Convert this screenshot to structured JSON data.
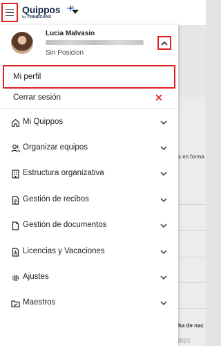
{
  "app": {
    "logo_main": "Quippos",
    "logo_sub_prefix": "by ",
    "logo_sub_brand": "FINNEGANS"
  },
  "colors": {
    "accent_red": "#e0201f",
    "brand_navy": "#1c2b4a",
    "star_blue": "#2b5fd9",
    "star_orange": "#f08a24"
  },
  "icons": {
    "menu": "hamburger-icon",
    "brand_dropdown": "chevron-down-icon",
    "collapse": "chevron-up-icon",
    "logout": "close-icon"
  },
  "user": {
    "name": "Lucia Malvasio",
    "position": "Sin Posicion"
  },
  "profile_menu": {
    "my_profile": "Mi perfil",
    "logout": "Cerrar sesión"
  },
  "menu": [
    {
      "label": "Mi Quippos",
      "icon": "home-icon"
    },
    {
      "label": "Organizar equipos",
      "icon": "people-icon"
    },
    {
      "label": "Estructura organizativa",
      "icon": "building-icon"
    },
    {
      "label": "Gestión de recibos",
      "icon": "receipt-icon"
    },
    {
      "label": "Gestión de documentos",
      "icon": "document-icon"
    },
    {
      "label": "Licencias y Vacaciones",
      "icon": "license-icon"
    },
    {
      "label": "Ajustes",
      "icon": "gear-icon"
    },
    {
      "label": "Maestros",
      "icon": "folder-check-icon"
    }
  ],
  "background": {
    "text_1": "x en forma",
    "text_2": "ha de nac",
    "text_3": "/01/1"
  }
}
